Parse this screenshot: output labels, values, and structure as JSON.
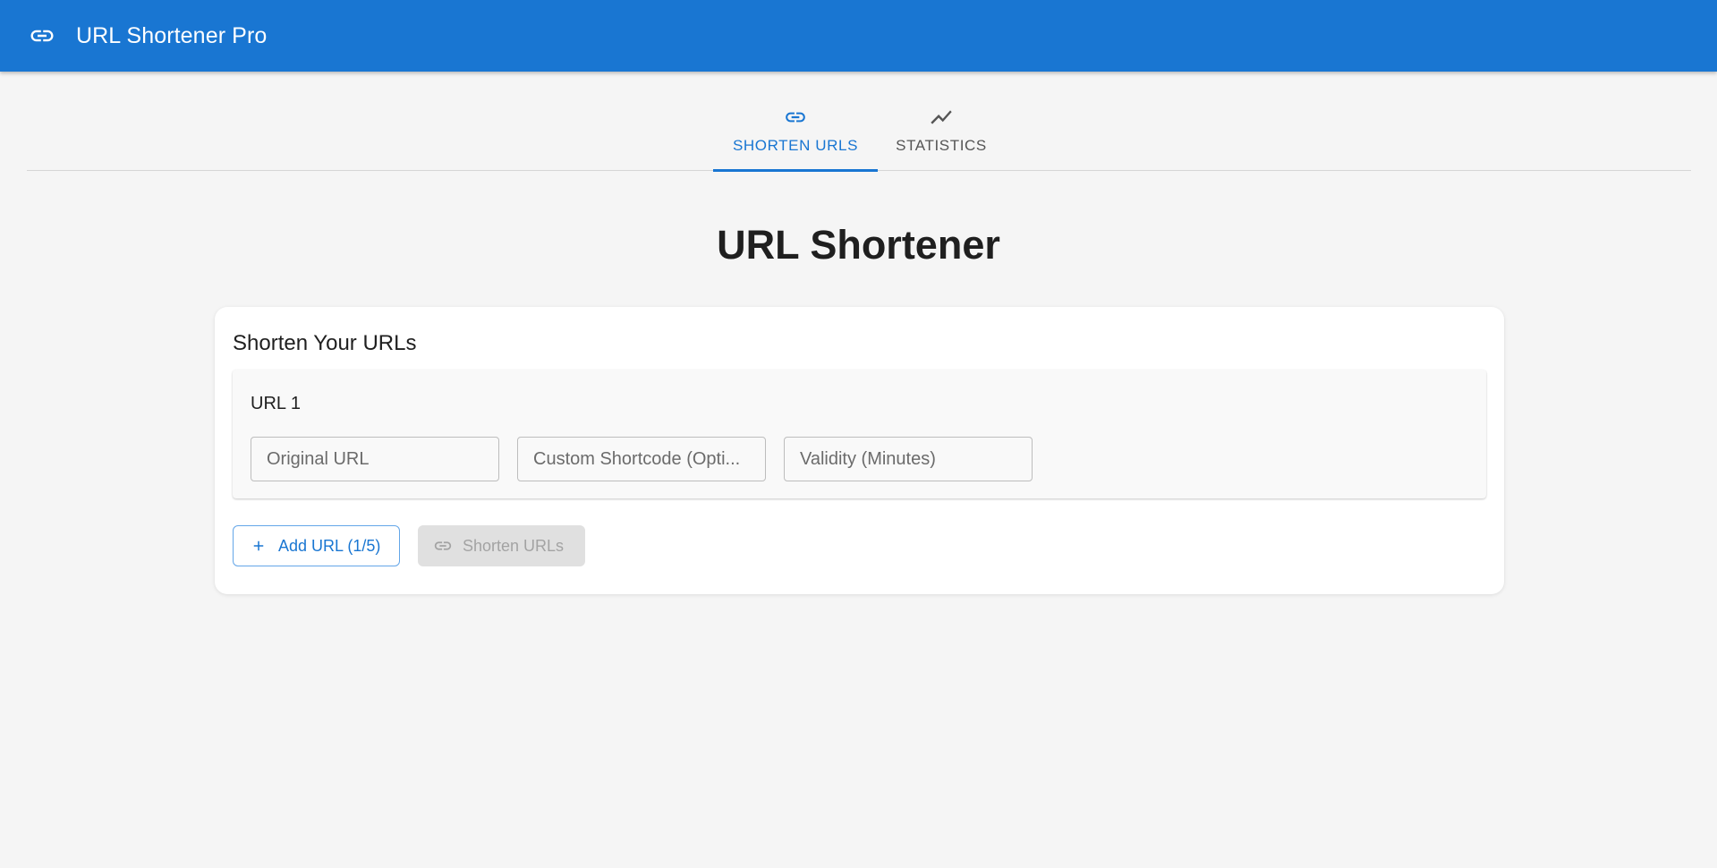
{
  "app": {
    "title": "URL Shortener Pro",
    "logo_icon": "link-icon",
    "brand_color": "#1976d2"
  },
  "tabs": [
    {
      "label": "SHORTEN URLS",
      "icon": "link-icon",
      "active": true
    },
    {
      "label": "STATISTICS",
      "icon": "trending-up-icon",
      "active": false
    }
  ],
  "page": {
    "title": "URL Shortener"
  },
  "card": {
    "title": "Shorten Your URLs",
    "url_entries": [
      {
        "label": "URL 1",
        "original_url": {
          "value": "",
          "placeholder": "Original URL"
        },
        "custom_shortcode": {
          "value": "",
          "placeholder": "Custom Shortcode (Opti..."
        },
        "validity": {
          "value": "",
          "placeholder": "Validity (Minutes)"
        }
      }
    ],
    "add_button": {
      "label": "Add URL (1/5)",
      "icon": "plus-icon"
    },
    "shorten_button": {
      "label": "Shorten URLs",
      "icon": "link-icon",
      "disabled": true
    }
  }
}
